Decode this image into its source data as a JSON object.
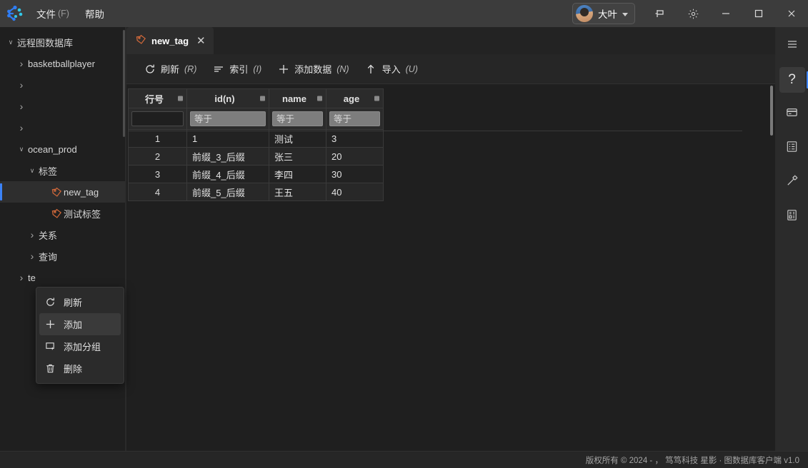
{
  "app": {
    "logo_icon": "graph-nodes-logo",
    "menus": [
      {
        "label": "文件",
        "mnemonic": "(F)"
      },
      {
        "label": "帮助",
        "mnemonic": ""
      }
    ],
    "user": {
      "name": "大叶",
      "avatar_icon": "user-avatar",
      "dropdown_icon": "chevron-down-icon"
    },
    "window_controls": [
      {
        "name": "pin-button",
        "icon": "pin-icon"
      },
      {
        "name": "settings-button",
        "icon": "gear-icon"
      },
      {
        "name": "minimize-button",
        "icon": "minimize-icon"
      },
      {
        "name": "maximize-button",
        "icon": "maximize-icon"
      },
      {
        "name": "close-button",
        "icon": "close-icon"
      }
    ]
  },
  "sidebar": {
    "tree": [
      {
        "label": "远程图数据库",
        "indent": 0,
        "twisty": "down",
        "icon": "none",
        "selected": false,
        "redacted": false
      },
      {
        "label": "basketballplayer",
        "indent": 1,
        "twisty": "right",
        "icon": "none",
        "selected": false,
        "redacted": false
      },
      {
        "label": "",
        "indent": 1,
        "twisty": "right",
        "icon": "none",
        "selected": false,
        "redacted": true,
        "redact_width": 44
      },
      {
        "label": "",
        "indent": 1,
        "twisty": "right",
        "icon": "none",
        "selected": false,
        "redacted": true,
        "redact_width": 28
      },
      {
        "label": "",
        "indent": 1,
        "twisty": "right",
        "icon": "none",
        "selected": false,
        "redacted": true,
        "redact_width": 48
      },
      {
        "label": "ocean_prod",
        "indent": 1,
        "twisty": "down",
        "icon": "none",
        "selected": false,
        "redacted": false
      },
      {
        "label": "标签",
        "indent": 2,
        "twisty": "down",
        "icon": "none",
        "selected": false,
        "redacted": false
      },
      {
        "label": "new_tag",
        "indent": 3,
        "twisty": "none",
        "icon": "tag-icon",
        "selected": true,
        "redacted": false
      },
      {
        "label": "测试标签",
        "indent": 3,
        "twisty": "none",
        "icon": "tag-icon",
        "selected": false,
        "redacted": false
      },
      {
        "label": "关系",
        "indent": 2,
        "twisty": "right",
        "icon": "none",
        "selected": false,
        "redacted": false
      },
      {
        "label": "查询",
        "indent": 2,
        "twisty": "right",
        "icon": "none",
        "selected": false,
        "redacted": false
      },
      {
        "label": "te",
        "indent": 1,
        "twisty": "right",
        "icon": "none",
        "selected": false,
        "redacted": false
      }
    ]
  },
  "context_menu": {
    "items": [
      {
        "label": "刷新",
        "icon": "refresh-icon",
        "active": false
      },
      {
        "label": "添加",
        "icon": "plus-icon",
        "active": true
      },
      {
        "label": "添加分组",
        "icon": "add-group-icon",
        "active": false
      },
      {
        "label": "删除",
        "icon": "trash-icon",
        "active": false
      }
    ]
  },
  "main": {
    "tab": {
      "label": "new_tag",
      "icon": "tag-icon",
      "close_icon": "close-icon"
    },
    "toolbar": [
      {
        "label": "刷新",
        "mnemonic": "(R)",
        "icon": "refresh-icon"
      },
      {
        "label": "索引",
        "mnemonic": "(I)",
        "icon": "index-lines-icon"
      },
      {
        "label": "添加数据",
        "mnemonic": "(N)",
        "icon": "plus-icon"
      },
      {
        "label": "导入",
        "mnemonic": "(U)",
        "icon": "upload-arrow-icon"
      }
    ],
    "table": {
      "columns": [
        "行号",
        "id(n)",
        "name",
        "age"
      ],
      "filter_placeholders": [
        "",
        "等于",
        "等于",
        "等于"
      ],
      "rows": [
        {
          "num": "1",
          "id": "1",
          "name": "测试",
          "age": "3"
        },
        {
          "num": "2",
          "id": "前缀_3_后缀",
          "name": "张三",
          "age": "20"
        },
        {
          "num": "3",
          "id": "前缀_4_后缀",
          "name": "李四",
          "age": "30"
        },
        {
          "num": "4",
          "id": "前缀_5_后缀",
          "name": "王五",
          "age": "40"
        }
      ]
    }
  },
  "rail": {
    "buttons": [
      {
        "name": "menu-button",
        "icon": "hamburger-icon",
        "active": false
      },
      {
        "name": "help-button",
        "icon": "question-mark-icon",
        "active": true
      },
      {
        "name": "card-button",
        "icon": "card-icon",
        "active": false
      },
      {
        "name": "list-button",
        "icon": "list-detail-icon",
        "active": false
      },
      {
        "name": "magic-button",
        "icon": "magic-wand-icon",
        "active": false
      },
      {
        "name": "document-button",
        "icon": "document-icon",
        "active": false
      }
    ]
  },
  "footer": {
    "copyright": "版权所有 © 2024 - ，  笃笃科技   星影 · 图数据库客户端  v1.0"
  },
  "colors": {
    "accent": "#3b82f6",
    "tag": "#d2693a",
    "bg": "#1f1f1f",
    "titlebar": "#3c3c3c"
  }
}
